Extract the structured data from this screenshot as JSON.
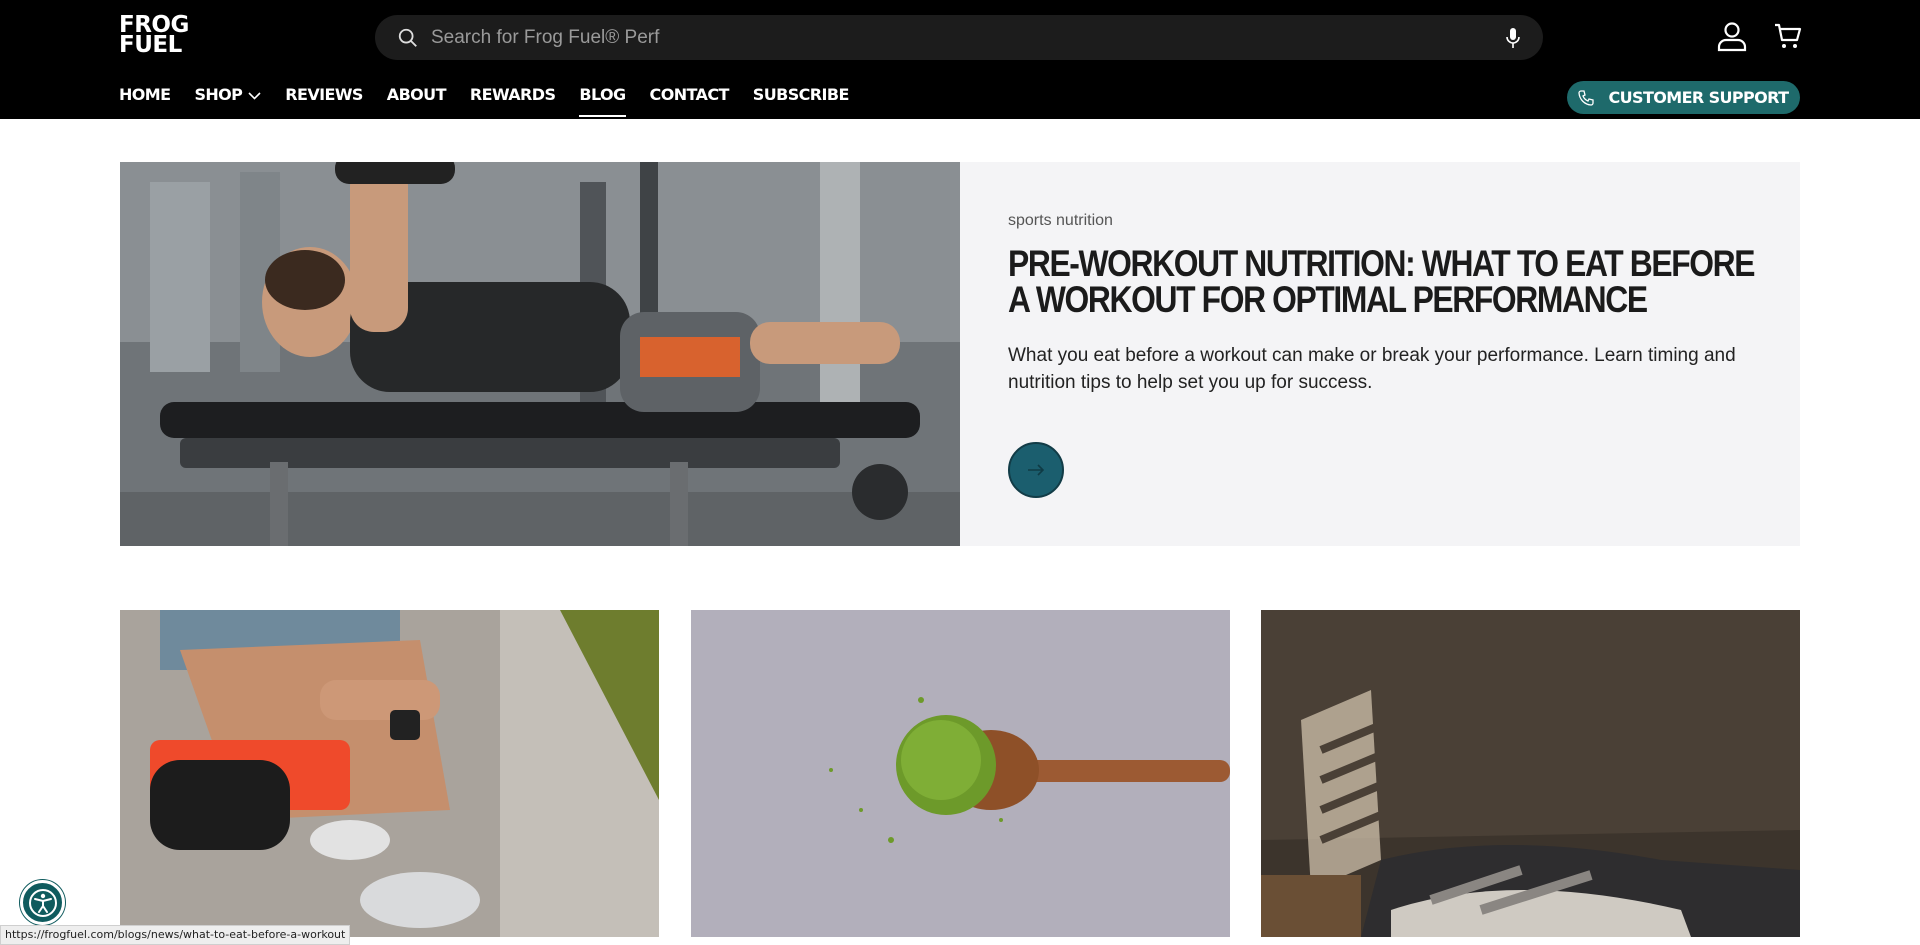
{
  "header": {
    "logo_line1": "FROG",
    "logo_line2": "FUEL",
    "search_placeholder": "Search for Frog Fuel® Perf",
    "icons": [
      "search-icon",
      "microphone-icon",
      "account-icon",
      "cart-icon"
    ]
  },
  "nav": {
    "items": [
      {
        "label": "HOME"
      },
      {
        "label": "SHOP"
      },
      {
        "label": "REVIEWS"
      },
      {
        "label": "ABOUT"
      },
      {
        "label": "REWARDS"
      },
      {
        "label": "BLOG"
      },
      {
        "label": "CONTACT"
      },
      {
        "label": "SUBSCRIBE"
      }
    ],
    "support_label": "CUSTOMER SUPPORT"
  },
  "hero": {
    "tag": "sports nutrition",
    "title": "PRE-WORKOUT NUTRITION: WHAT TO EAT BEFORE A WORKOUT FOR OPTIMAL PERFORMANCE",
    "description": "What you eat before a workout can make or break your performance. Learn timing and nutrition tips to help set you up for success."
  },
  "status_url": "https://frogfuel.com/blogs/news/what-to-eat-before-a-workout",
  "colors": {
    "header_bg": "#000000",
    "accent_teal": "#1e6a6b",
    "hero_bg": "#f4f4f6"
  }
}
